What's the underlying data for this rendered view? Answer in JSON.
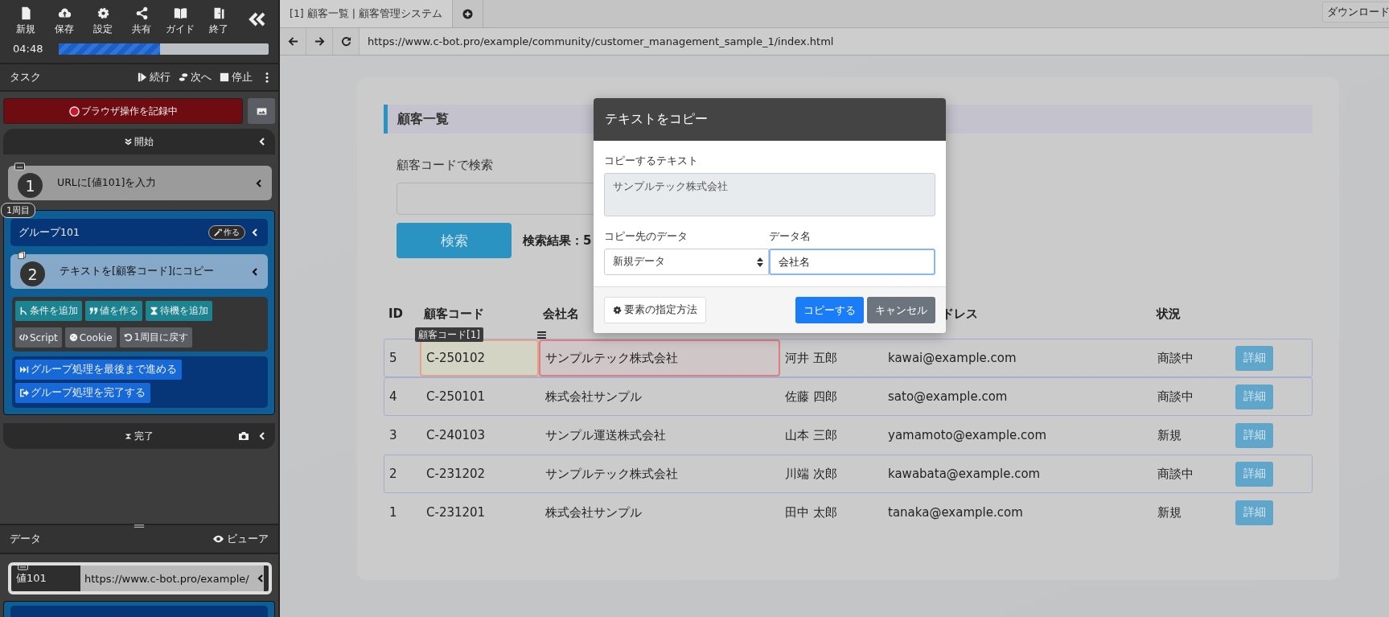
{
  "sidebar": {
    "toolbar": [
      {
        "label": "新規"
      },
      {
        "label": "保存"
      },
      {
        "label": "設定"
      },
      {
        "label": "共有"
      },
      {
        "label": "ガイド"
      },
      {
        "label": "終了"
      }
    ],
    "timer": "04:48",
    "progress": {
      "level": 0.48
    },
    "task_header": {
      "title": "タスク",
      "actions": [
        {
          "label": "続行"
        },
        {
          "label": "次へ"
        },
        {
          "label": "停止"
        }
      ]
    },
    "record_button": "ブラウザ操作を記録中",
    "start": "開始",
    "step_1": {
      "number": "1",
      "text": "URLに[値101]を入力"
    },
    "group": {
      "badge": "1周目",
      "title": "グループ101",
      "make_button": "作る",
      "step_2": {
        "number": "2",
        "text": "テキストを[顧客コード]にコピー"
      },
      "actions": [
        {
          "label": "条件を追加",
          "kind": "add"
        },
        {
          "label": "値を作る",
          "kind": "add"
        },
        {
          "label": "待機を追加",
          "kind": "add"
        },
        {
          "label": "Script",
          "kind": "tool"
        },
        {
          "label": "Cookie",
          "kind": "tool"
        },
        {
          "label": "1周目に戻す",
          "kind": "tool"
        }
      ],
      "group_buttons": [
        {
          "label": "グループ処理を最後まで進める"
        },
        {
          "label": "グループ処理を完了する"
        }
      ]
    },
    "done": "完了",
    "data_panel": {
      "title": "データ",
      "viewer": "ビューア",
      "rows": [
        {
          "name": "値101",
          "value": "https://www.c-bot.pro/example/"
        }
      ]
    }
  },
  "browser": {
    "tabs": [
      {
        "label": "[1] 顧客一覧 | 顧客管理システム",
        "selected": true
      }
    ],
    "download_button": "ダウンロード",
    "url": "https://www.c-bot.pro/example/community/customer_management_sample_1/index.html"
  },
  "page": {
    "heading": "顧客一覧",
    "search_label": "顧客コードで検索",
    "search_button": "検索",
    "result": "検索結果：5",
    "table": {
      "columns": [
        "ID",
        "顧客コード",
        "会社名",
        "",
        "ドレス",
        "状況"
      ],
      "rows": [
        {
          "id": "5",
          "code": "C-250102",
          "company": "サンプルテック株式会社",
          "person": "河井 五郎",
          "email": "kawai@example.com",
          "status": "商談中",
          "button": "詳細",
          "outlined": true,
          "code_marked": true,
          "company_marked": true,
          "tooltip": "顧客コード[1]"
        },
        {
          "id": "4",
          "code": "C-250101",
          "company": "株式会社サンプル",
          "person": "佐藤 四郎",
          "email": "sato@example.com",
          "status": "商談中",
          "button": "詳細",
          "outlined": true,
          "code_marked": false,
          "company_marked": false
        },
        {
          "id": "3",
          "code": "C-240103",
          "company": "サンプル運送株式会社",
          "person": "山本 三郎",
          "email": "yamamoto@example.com",
          "status": "新規",
          "button": "詳細",
          "outlined": false,
          "code_marked": false,
          "company_marked": false
        },
        {
          "id": "2",
          "code": "C-231202",
          "company": "サンプルテック株式会社",
          "person": "川端 次郎",
          "email": "kawabata@example.com",
          "status": "商談中",
          "button": "詳細",
          "outlined": true,
          "code_marked": false,
          "company_marked": false
        },
        {
          "id": "1",
          "code": "C-231201",
          "company": "株式会社サンプル",
          "person": "田中 太郎",
          "email": "tanaka@example.com",
          "status": "新規",
          "button": "詳細",
          "outlined": false,
          "code_marked": false,
          "company_marked": false
        }
      ]
    }
  },
  "dialog": {
    "title": "テキストをコピー",
    "text_label": "コピーするテキスト",
    "text_value": "サンプルテック株式会社",
    "target_label": "コピー先のデータ",
    "target_value": "新規データ",
    "name_label": "データ名",
    "name_value": "会社名",
    "method_button": "要素の指定方法",
    "copy_button": "コピーする",
    "cancel_button": "キャンセル"
  }
}
